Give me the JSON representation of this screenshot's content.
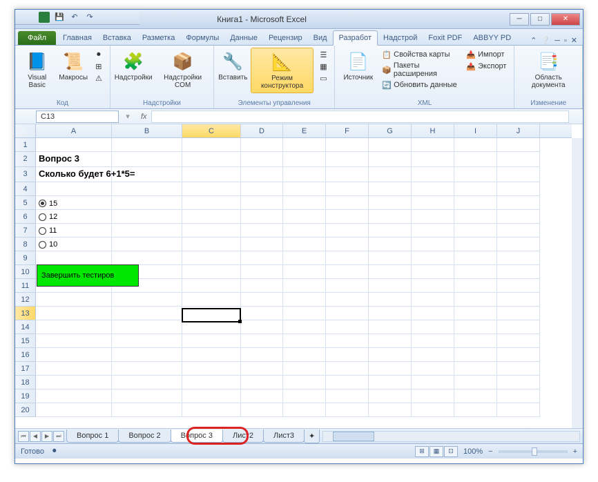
{
  "title": "Книга1 - Microsoft Excel",
  "tabs": {
    "file": "Файл",
    "items": [
      "Главная",
      "Вставка",
      "Разметка",
      "Формулы",
      "Данные",
      "Рецензир",
      "Вид",
      "Разработ",
      "Надстрой",
      "Foxit PDF",
      "ABBYY PD"
    ],
    "active": 7
  },
  "ribbon": {
    "g1": {
      "label": "Код",
      "vb": "Visual\nBasic",
      "mac": "Макросы"
    },
    "g2": {
      "label": "Надстройки",
      "n1": "Надстройки",
      "n2": "Надстройки\nCOM"
    },
    "g3": {
      "label": "Элементы управления",
      "ins": "Вставить",
      "design": "Режим\nконструктора"
    },
    "g4": {
      "label": "XML",
      "src": "Источник",
      "p1": "Свойства карты",
      "p2": "Пакеты расширения",
      "p3": "Обновить данные",
      "imp": "Импорт",
      "exp": "Экспорт"
    },
    "g5": {
      "label": "Изменение",
      "doc": "Область\nдокумента"
    }
  },
  "namebox": "C13",
  "cols": [
    "A",
    "B",
    "C",
    "D",
    "E",
    "F",
    "G",
    "H",
    "I",
    "J"
  ],
  "content": {
    "title": "Вопрос 3",
    "question": "Сколько будет 6+1*5=",
    "options": [
      {
        "v": "15",
        "sel": true
      },
      {
        "v": "12",
        "sel": false
      },
      {
        "v": "11",
        "sel": false
      },
      {
        "v": "10",
        "sel": false
      }
    ],
    "button": "Завершить тестиров"
  },
  "sheets": [
    {
      "n": "Вопрос 1"
    },
    {
      "n": "Вопрос 2"
    },
    {
      "n": "Вопрос 3",
      "active": true
    },
    {
      "n": "Лист2"
    },
    {
      "n": "Лист3"
    }
  ],
  "status": {
    "ready": "Готово",
    "zoom": "100%"
  },
  "active_cell": {
    "ref": "C13",
    "row": 13,
    "col": "C"
  }
}
